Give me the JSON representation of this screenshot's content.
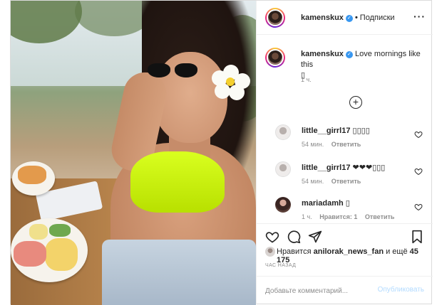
{
  "post": {
    "author": "kamenskux",
    "follow_label": "Подписки",
    "more_icon": "ellipsis-icon",
    "caption": {
      "author": "kamenskux",
      "text": "Love mornings like this",
      "emoji": "▯",
      "time": "1 ч."
    },
    "load_more_icon": "plus-circle-icon",
    "comments": [
      {
        "user": "little__girrl17",
        "text": "▯▯▯▯",
        "time": "54 мин.",
        "reply": "Ответить"
      },
      {
        "user": "little__girrl17",
        "text": "❤❤❤▯▯▯",
        "time": "54 мин.",
        "reply": "Ответить"
      },
      {
        "user": "mariadamh",
        "text": "▯",
        "time": "1 ч.",
        "likes": "Нравится: 1",
        "reply": "Ответить"
      }
    ],
    "likes": {
      "prefix": "Нравится",
      "user": "anilorak_news_fan",
      "middle": "и ещё",
      "count": "45 175"
    },
    "ago": "ЧАС НАЗАД",
    "add_comment": {
      "placeholder": "Добавьте комментарий...",
      "publish_label": "Опубликовать"
    },
    "colors": {
      "verified": "#3897f0",
      "publish_disabled": "#b3dbff",
      "border": "#dbdbdb"
    }
  }
}
